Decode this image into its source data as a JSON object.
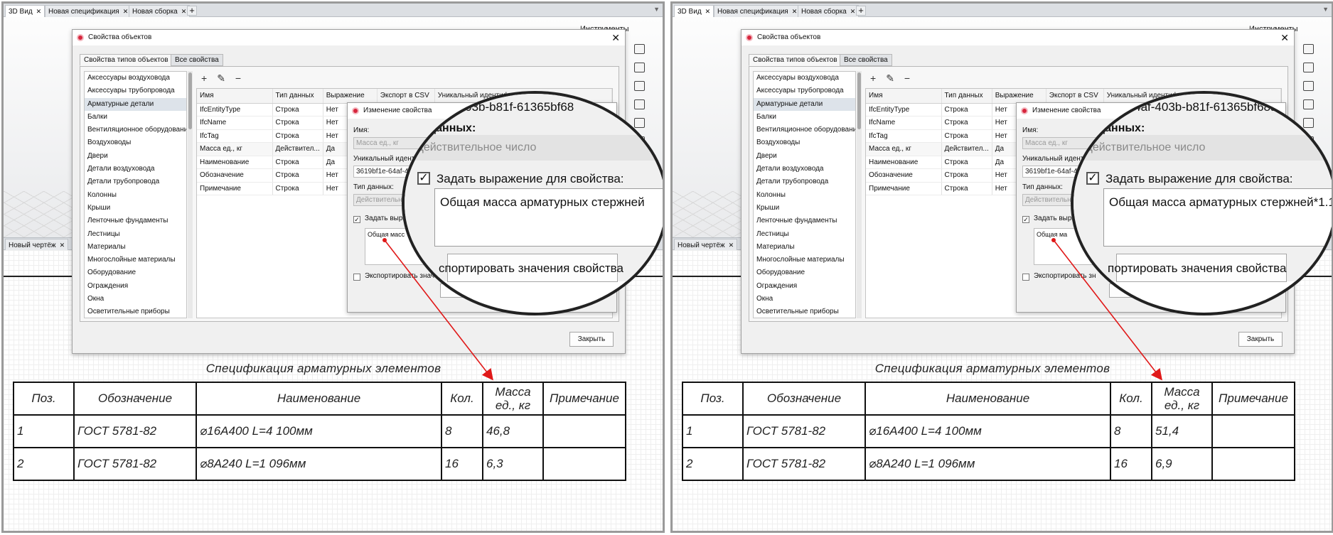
{
  "panels": [
    {
      "tabs": [
        "3D Вид",
        "Новая спецификация",
        "Новая сборка"
      ],
      "toolpanel_title": "Инструменты",
      "drawing_tab": "Новый чертёж",
      "dialog": {
        "title": "Свойства объектов",
        "tabs": [
          "Свойства типов объектов",
          "Все свойства"
        ],
        "types": [
          "Аксессуары воздуховода",
          "Аксессуары трубопровода",
          "Арматурные детали",
          "Балки",
          "Вентиляционное оборудование",
          "Воздуховоды",
          "Двери",
          "Детали воздуховода",
          "Детали трубопровода",
          "Колонны",
          "Крыши",
          "Ленточные фундаменты",
          "Лестницы",
          "Материалы",
          "Многослойные материалы",
          "Оборудование",
          "Ограждения",
          "Окна",
          "Осветительные приборы"
        ],
        "columns": [
          "Имя",
          "Тип данных",
          "Выражение",
          "Экспорт в CSV",
          "Уникальный идентификатор"
        ],
        "rows": [
          [
            "IfcEntityType",
            "Строка",
            "Нет"
          ],
          [
            "IfcName",
            "Строка",
            "Нет"
          ],
          [
            "IfcTag",
            "Строка",
            "Нет"
          ],
          [
            "Масса ед., кг",
            "Действител...",
            "Да"
          ],
          [
            "Наименование",
            "Строка",
            "Да"
          ],
          [
            "Обозначение",
            "Строка",
            "Нет"
          ],
          [
            "Примечание",
            "Строка",
            "Нет"
          ]
        ],
        "close_label": "Закрыть"
      },
      "dialog2": {
        "title": "Изменение свойства",
        "name_label": "Имя:",
        "name_value": "Масса ед., кг",
        "uid_label": "Уникальный идент",
        "uid_value": "3619bf1e-64af-4",
        "type_label": "Тип данных:",
        "type_value": "Действительно",
        "expr_check_label": "Задать выра",
        "expr_value": "Общая масс",
        "export_label": "Экспортировать значения"
      },
      "lens": {
        "uid": "-403b-b81f-61365bf68",
        "type_label": "данных:",
        "type_value": "Действительное число",
        "check_label": "Задать выражение для свойства:",
        "expression": "Общая масса арматурных стержней",
        "export_label": "спортировать значения свойства"
      },
      "spec": {
        "title": "Спецификация арматурных элементов",
        "headers": [
          "Поз.",
          "Обозначение",
          "Наименование",
          "Кол.",
          "Масса ед., кг",
          "Примечание"
        ],
        "rows": [
          [
            "1",
            "ГОСТ 5781-82",
            "⌀16А400 L=4 100мм",
            "8",
            "46,8",
            ""
          ],
          [
            "2",
            "ГОСТ 5781-82",
            "⌀8А240 L=1 096мм",
            "16",
            "6,3",
            ""
          ]
        ]
      }
    },
    {
      "tabs": [
        "3D Вид",
        "Новая спецификация",
        "Новая сборка"
      ],
      "toolpanel_title": "Инструменты",
      "drawing_tab": "Новый чертёж",
      "dialog": {
        "title": "Свойства объектов",
        "tabs": [
          "Свойства типов объектов",
          "Все свойства"
        ],
        "types": [
          "Аксессуары воздуховода",
          "Аксессуары трубопровода",
          "Арматурные детали",
          "Балки",
          "Вентиляционное оборудование",
          "Воздуховоды",
          "Двери",
          "Детали воздуховода",
          "Детали трубопровода",
          "Колонны",
          "Крыши",
          "Ленточные фундаменты",
          "Лестницы",
          "Материалы",
          "Многослойные материалы",
          "Оборудование",
          "Ограждения",
          "Окна",
          "Осветительные приборы"
        ],
        "columns": [
          "Имя",
          "Тип данных",
          "Выражение",
          "Экспорт в CSV",
          "Уникальный идентификатор"
        ],
        "rows": [
          [
            "IfcEntityType",
            "Строка",
            "Нет"
          ],
          [
            "IfcName",
            "Строка",
            "Нет"
          ],
          [
            "IfcTag",
            "Строка",
            "Нет"
          ],
          [
            "Масса ед., кг",
            "Действител...",
            "Да"
          ],
          [
            "Наименование",
            "Строка",
            "Да"
          ],
          [
            "Обозначение",
            "Строка",
            "Нет"
          ],
          [
            "Примечание",
            "Строка",
            "Нет"
          ]
        ],
        "close_label": "Закрыть"
      },
      "dialog2": {
        "title": "Изменение свойства",
        "name_label": "Имя:",
        "name_value": "Масса ед., кг",
        "uid_label": "Уникальный идент",
        "uid_value": "3619bf1e-64af-4",
        "type_label": "Тип данных:",
        "type_value": "Действительно",
        "expr_check_label": "Задать выра",
        "expr_value": "Общая ма",
        "export_label": "Экспортировать зн"
      },
      "lens": {
        "uid": "-64af-403b-b81f-61365bf68a",
        "type_label": "данных:",
        "type_value": "Действительное число",
        "check_label": "Задать выражение для свойства:",
        "expression": "Общая масса арматурных стержней*1.1",
        "export_label": "портировать значения свойства"
      },
      "spec": {
        "title": "Спецификация арматурных элементов",
        "headers": [
          "Поз.",
          "Обозначение",
          "Наименование",
          "Кол.",
          "Масса ед., кг",
          "Примечание"
        ],
        "rows": [
          [
            "1",
            "ГОСТ 5781-82",
            "⌀16А400 L=4 100мм",
            "8",
            "51,4",
            ""
          ],
          [
            "2",
            "ГОСТ 5781-82",
            "⌀8А240 L=1 096мм",
            "16",
            "6,9",
            ""
          ]
        ]
      }
    }
  ]
}
